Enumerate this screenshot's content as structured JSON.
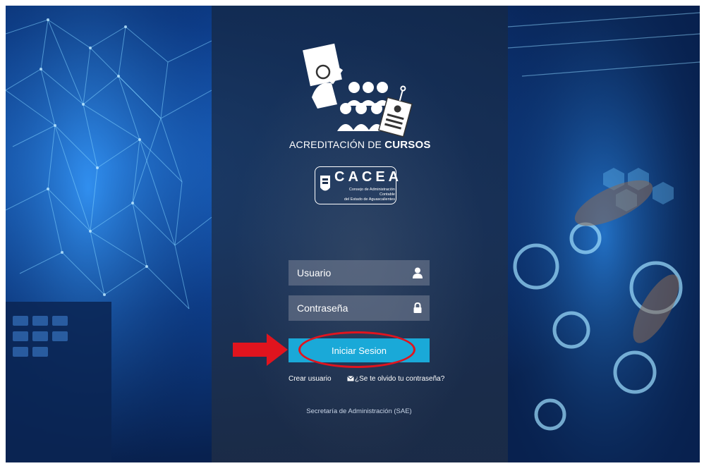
{
  "brand": {
    "title_prefix": "ACREDITACIÓN DE ",
    "title_bold": "CURSOS",
    "org_logo_text": "CACEA",
    "org_logo_subtitle_1": "Consejo de Administración Contable",
    "org_logo_subtitle_2": "del Estado de Aguascalientes"
  },
  "form": {
    "username_placeholder": "Usuario",
    "password_placeholder": "Contraseña",
    "username_icon": "user-icon",
    "password_icon": "lock-icon",
    "login_label": "Iniciar Sesion",
    "create_user_label": "Crear usuario",
    "forgot_label": "¿Se te olvido tu contraseña?",
    "forgot_icon": "envelope-icon"
  },
  "footer": {
    "text": "Secretaría de Administración (SAE)"
  },
  "annotations": {
    "highlight_color": "#e0141e",
    "arrow_color": "#e0141e"
  },
  "colors": {
    "button": "#1aa9d8",
    "panel": "#1c304e"
  }
}
